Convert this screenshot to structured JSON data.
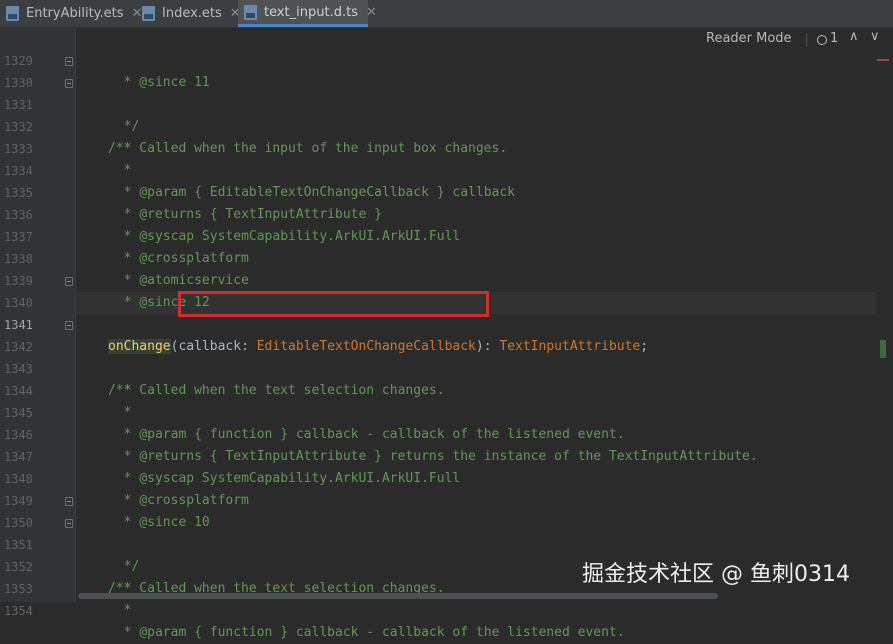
{
  "tabs": [
    {
      "label": "EntryAbility.ets",
      "active": false,
      "close": "✕"
    },
    {
      "label": "Index.ets",
      "active": false,
      "close": "✕"
    },
    {
      "label": "text_input.d.ts",
      "active": true,
      "close": "✕"
    }
  ],
  "find_bar": {
    "reader_mode": "Reader Mode",
    "match_count": "1",
    "up": "∧",
    "down": "∨"
  },
  "lines": {
    "l1329": {
      "num": "1329",
      "text": "  * @since 11"
    },
    "l1330": {
      "num": "1330",
      "text": "  */"
    },
    "l1331": {
      "num": "1331",
      "text": "/**"
    },
    "l1332": {
      "num": "1332",
      "text": "  * Called when the input of the input box changes."
    },
    "l1333": {
      "num": "1333",
      "text": "  *"
    },
    "l1334": {
      "num": "1334",
      "pre": "  * ",
      "tag": "@param",
      "rest": " { EditableTextOnChangeCallback } callback"
    },
    "l1335": {
      "num": "1335",
      "pre": "  * ",
      "tag": "@returns",
      "rest": " { TextInputAttribute }"
    },
    "l1336": {
      "num": "1336",
      "pre": "  * ",
      "tag": "@syscap",
      "rest": " SystemCapability.ArkUI.ArkUI.Full"
    },
    "l1337": {
      "num": "1337",
      "pre": "  * ",
      "tag": "@crossplatform",
      "rest": ""
    },
    "l1338": {
      "num": "1338",
      "pre": "  * ",
      "tag": "@atomicservice",
      "rest": ""
    },
    "l1339": {
      "num": "1339",
      "pre": "  * ",
      "tag": "@since",
      "rest": " 12"
    },
    "l1340": {
      "num": "1340",
      "text": "  */"
    },
    "l1341": {
      "num": "1341",
      "fn": "onChange",
      "open": "(",
      "param": "callback",
      "colon": ": ",
      "ptype": "EditableTextOnChangeCallback",
      "close": ")",
      "ret_sep": ": ",
      "rtype": "TextInputAttribute",
      "semi": ";"
    },
    "l1342": {
      "num": "1342",
      "text": "/**"
    },
    "l1343": {
      "num": "1343",
      "text": "  * Called when the text selection changes."
    },
    "l1344": {
      "num": "1344",
      "text": "  *"
    },
    "l1345": {
      "num": "1345",
      "pre": "  * ",
      "tag": "@param",
      "rest": " { function } callback - callback of the listened event."
    },
    "l1346": {
      "num": "1346",
      "pre": "  * ",
      "tag": "@returns",
      "rest": " { TextInputAttribute } returns the instance of the TextInputAttribute."
    },
    "l1347": {
      "num": "1347",
      "pre": "  * ",
      "tag": "@syscap",
      "rest": " SystemCapability.ArkUI.ArkUI.Full"
    },
    "l1348": {
      "num": "1348",
      "pre": "  * ",
      "tag": "@crossplatform",
      "rest": ""
    },
    "l1349": {
      "num": "1349",
      "pre": "  * ",
      "tag": "@since",
      "rest": " 10"
    },
    "l1350": {
      "num": "1350",
      "text": "  */"
    },
    "l1351": {
      "num": "1351",
      "text": "/**"
    },
    "l1352": {
      "num": "1352",
      "text": "  * Called when the text selection changes."
    },
    "l1353": {
      "num": "1353",
      "text": "  *"
    },
    "l1354": {
      "num": "1354",
      "pre": "  * ",
      "tag": "@param",
      "rest": " { function } callback - callback of the listened event."
    }
  },
  "watermark": "掘金技术社区 @ 鱼刺0314",
  "colors": {
    "background": "#2b2b2b",
    "comment": "#629755",
    "keyword": "#cc7832",
    "function": "#ffc66d",
    "highlight_box": "#d42d2d"
  }
}
